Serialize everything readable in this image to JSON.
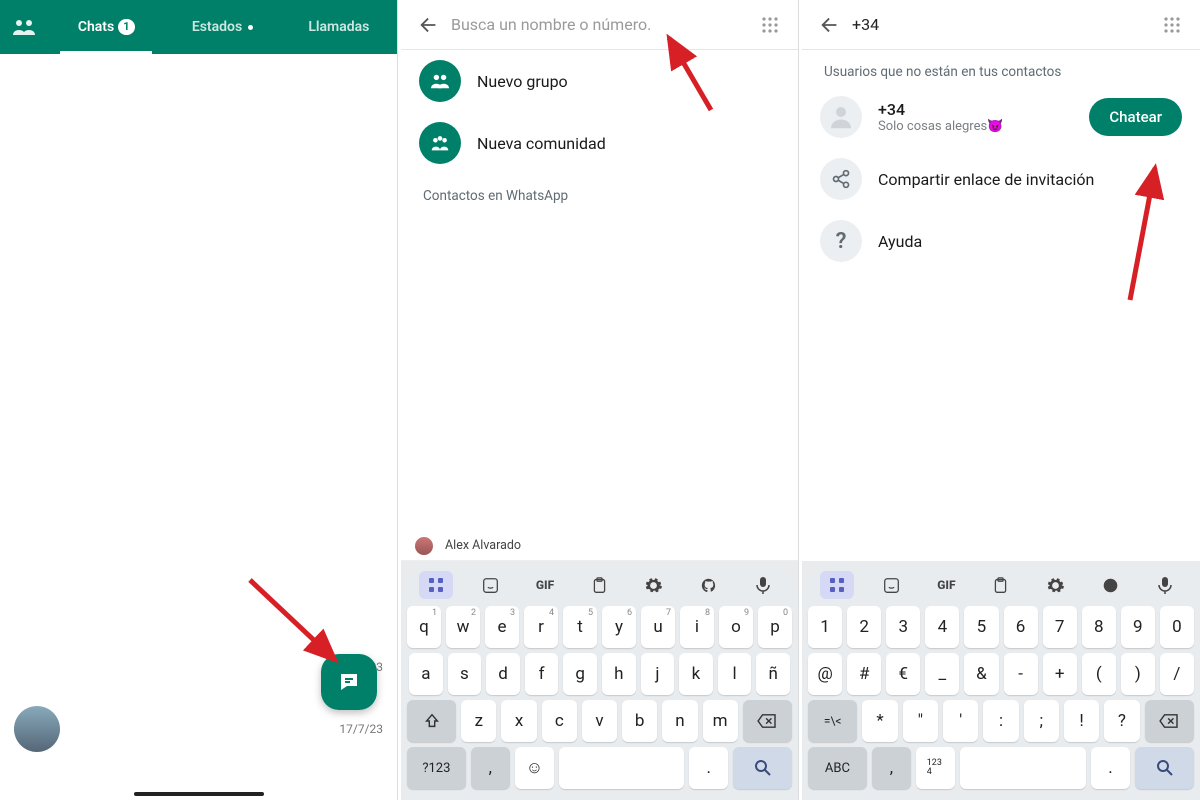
{
  "panel1": {
    "tabs": {
      "chats": "Chats",
      "badge": "1",
      "states": "Estados",
      "calls": "Llamadas"
    },
    "chat_dates": [
      "18/7/23",
      "17/7/23"
    ]
  },
  "panel2": {
    "search_placeholder": "Busca un nombre o número.",
    "new_group": "Nuevo grupo",
    "new_community": "Nueva comunidad",
    "contacts_section": "Contactos en WhatsApp",
    "partial_contact": "Alex Alvarado"
  },
  "panel3": {
    "search_value": "+34",
    "section": "Usuarios que no están en tus contactos",
    "contact_number": "+34",
    "contact_status": "Solo cosas alegres😈",
    "chat_btn": "Chatear",
    "share": "Compartir enlace de invitación",
    "help": "Ayuda"
  },
  "keyboard_alpha": {
    "tools": [
      "⊞",
      "☺",
      "GIF",
      "📋",
      "⚙",
      "🎨",
      "🎤"
    ],
    "row1": [
      [
        "q",
        "1"
      ],
      [
        "w",
        "2"
      ],
      [
        "e",
        "3"
      ],
      [
        "r",
        "4"
      ],
      [
        "t",
        "5"
      ],
      [
        "y",
        "6"
      ],
      [
        "u",
        "7"
      ],
      [
        "i",
        "8"
      ],
      [
        "o",
        "9"
      ],
      [
        "p",
        "0"
      ]
    ],
    "row2": [
      "a",
      "s",
      "d",
      "f",
      "g",
      "h",
      "j",
      "k",
      "l",
      "ñ"
    ],
    "row3": [
      "z",
      "x",
      "c",
      "v",
      "b",
      "n",
      "m"
    ],
    "sym": "?123"
  },
  "keyboard_num": {
    "row1": [
      "1",
      "2",
      "3",
      "4",
      "5",
      "6",
      "7",
      "8",
      "9",
      "0"
    ],
    "row2": [
      "@",
      "#",
      "€",
      "_",
      "&",
      "-",
      "+",
      "(",
      ")",
      "/"
    ],
    "row3": [
      "*",
      "\"",
      "'",
      ":",
      ";",
      "!",
      "?"
    ],
    "shift": "=\\<",
    "abc": "ABC",
    "numswitch": "1234"
  }
}
